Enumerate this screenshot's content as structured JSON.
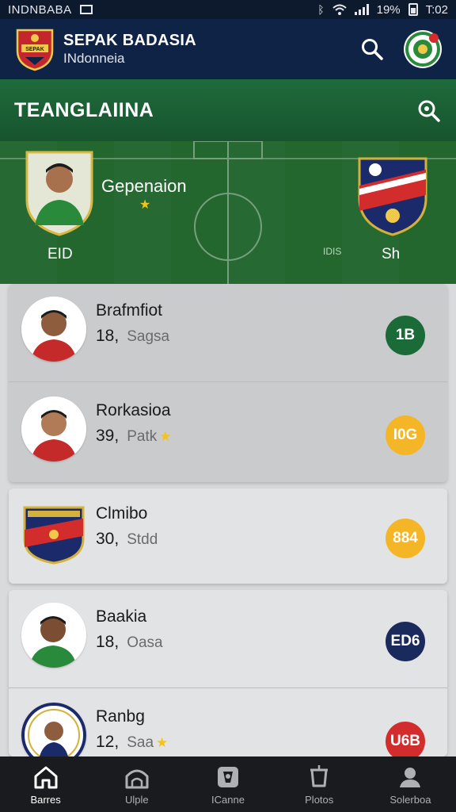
{
  "status_bar": {
    "carrier": "INDNBABA",
    "battery": "19%",
    "time": "T:02"
  },
  "header": {
    "title": "SEPAK BADASIA",
    "subtitle": "INdonneia"
  },
  "section": {
    "title": "TEANGLAIINA"
  },
  "hero": {
    "player_label": "EID",
    "title": "Gepenaion",
    "club_label": "Sh",
    "mid_label": "IDIS"
  },
  "list": [
    {
      "name": "Brafmfiot",
      "number": "18,",
      "sub": "Sagsa",
      "star": false,
      "badge": "1B",
      "badge_color": "#1a6b38"
    },
    {
      "name": "Rorkasioa",
      "number": "39,",
      "sub": "Patk",
      "star": true,
      "badge": "I0G",
      "badge_color": "#f4b526"
    },
    {
      "name": "Clmibo",
      "number": "30,",
      "sub": "Stdd",
      "star": false,
      "badge": "884",
      "badge_color": "#f4b526"
    },
    {
      "name": "Baakia",
      "number": "18,",
      "sub": "Oasa",
      "star": false,
      "badge": "ED6",
      "badge_color": "#1b2a5c"
    },
    {
      "name": "Ranbg",
      "number": "12,",
      "sub": "Saa",
      "star": true,
      "badge": "U6B",
      "badge_color": "#d22c2c"
    }
  ],
  "nav": [
    {
      "label": "Barres",
      "icon": "home-icon",
      "active": true
    },
    {
      "label": "Ulple",
      "icon": "stadium-icon",
      "active": false
    },
    {
      "label": "ICanne",
      "icon": "team-icon",
      "active": false
    },
    {
      "label": "Plotos",
      "icon": "trophy-icon",
      "active": false
    },
    {
      "label": "Solerboa",
      "icon": "profile-icon",
      "active": false
    }
  ]
}
